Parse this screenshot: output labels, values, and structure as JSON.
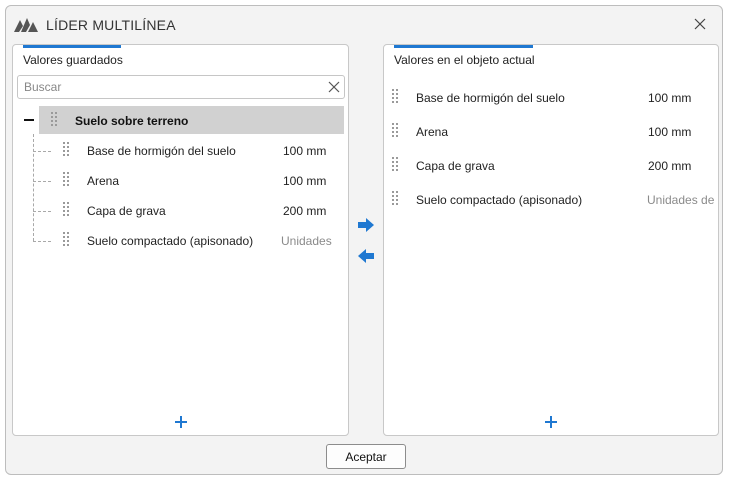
{
  "window": {
    "title": "LÍDER MULTILÍNEA",
    "logo_icon": "app-logo-icon",
    "close_icon": "close-icon"
  },
  "saved_values": {
    "header": "Valores guardados",
    "search": {
      "placeholder": "Buscar",
      "value": ""
    },
    "group": {
      "label": "Suelo sobre terreno",
      "expanded": true
    },
    "items": [
      {
        "label": "Base de hormigón del suelo",
        "value": "100 mm",
        "muted": false
      },
      {
        "label": "Arena",
        "value": "100 mm",
        "muted": false
      },
      {
        "label": "Capa de grava",
        "value": "200 mm",
        "muted": false
      },
      {
        "label": "Suelo compactado (apisonado)",
        "value": "Unidades",
        "muted": true
      }
    ],
    "add_icon": "plus-icon"
  },
  "transfer": {
    "to_right_icon": "arrow-right-icon",
    "to_left_icon": "arrow-left-icon"
  },
  "current_values": {
    "header": "Valores en el objeto actual",
    "items": [
      {
        "label": "Base de hormigón del suelo",
        "value": "100 mm",
        "muted": false
      },
      {
        "label": "Arena",
        "value": "100 mm",
        "muted": false
      },
      {
        "label": "Capa de grava",
        "value": "200 mm",
        "muted": false
      },
      {
        "label": "Suelo compactado (apisonado)",
        "value": "Unidades de",
        "muted": true
      }
    ],
    "add_icon": "plus-icon"
  },
  "footer": {
    "ok_label": "Aceptar"
  },
  "colors": {
    "accent": "#1f78d1",
    "selected_row": "#d1d1d1",
    "muted_text": "#8a8a8a"
  }
}
